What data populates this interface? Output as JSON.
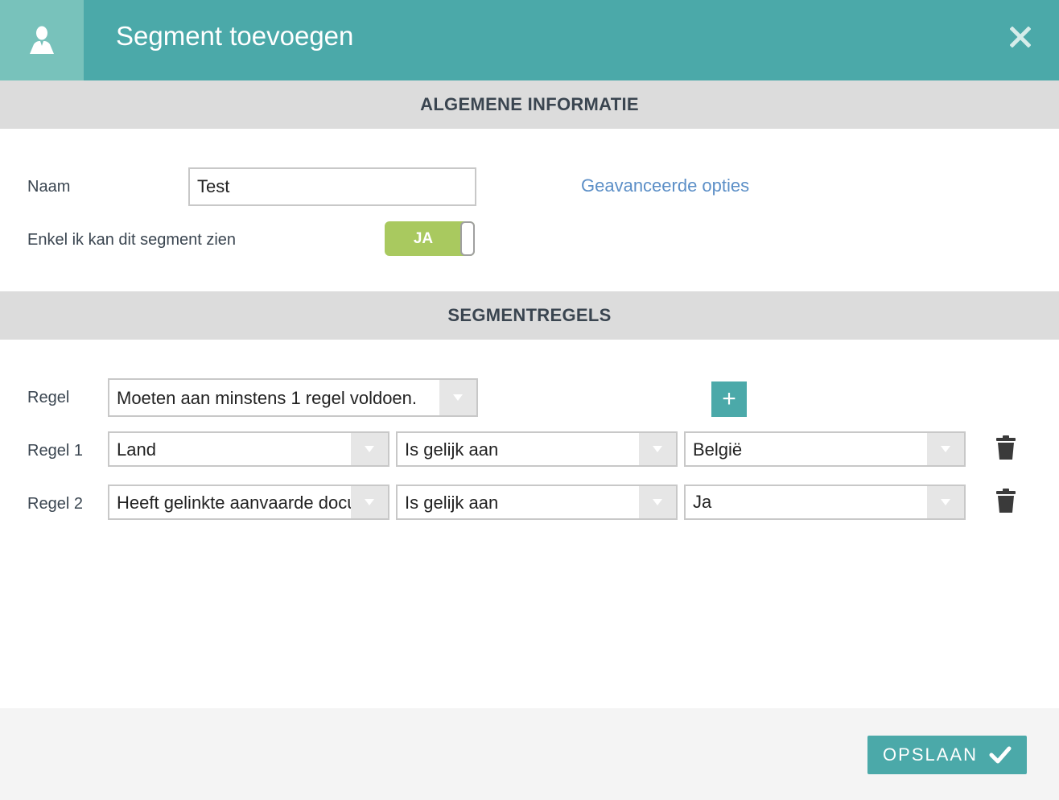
{
  "header": {
    "title": "Segment toevoegen",
    "icon": "user-icon",
    "close_icon": "close-icon"
  },
  "sections": {
    "general": "ALGEMENE INFORMATIE",
    "rules": "SEGMENTREGELS"
  },
  "form": {
    "name_label": "Naam",
    "name_value": "Test",
    "advanced_link": "Geavanceerde opties",
    "private_label": "Enkel ik kan dit segment zien",
    "private_toggle": "JA"
  },
  "rules": {
    "match_label": "Regel",
    "match_value": "Moeten aan minstens 1 regel voldoen.",
    "add_icon": "+",
    "rows": [
      {
        "label": "Regel 1",
        "field": "Land",
        "operator": "Is gelijk aan",
        "value": "België"
      },
      {
        "label": "Regel 2",
        "field": "Heeft gelinkte aanvaarde documenten",
        "operator": "Is gelijk aan",
        "value": "Ja"
      }
    ]
  },
  "footer": {
    "save_label": "OPSLAAN",
    "save_icon": "check-icon"
  },
  "colors": {
    "accent": "#4ba9a9",
    "accent_light": "#78c2bb",
    "toggle_on": "#a9c95f",
    "link": "#5c8fc7",
    "section_bg": "#dcdcdc"
  }
}
